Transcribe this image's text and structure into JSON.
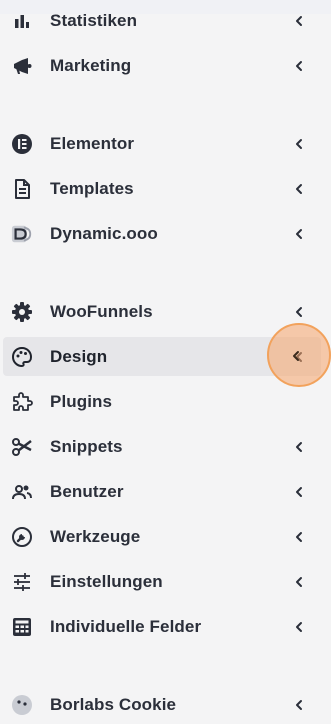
{
  "menu": {
    "items": [
      {
        "label": "Statistiken",
        "icon": "bar-chart-icon"
      },
      {
        "label": "Marketing",
        "icon": "megaphone-icon"
      },
      {
        "label": "Elementor",
        "icon": "elementor-icon"
      },
      {
        "label": "Templates",
        "icon": "document-icon"
      },
      {
        "label": "Dynamic.ooo",
        "icon": "dynamic-logo-icon"
      },
      {
        "label": "WooFunnels",
        "icon": "gear-icon"
      },
      {
        "label": "Design",
        "icon": "palette-icon",
        "active": true
      },
      {
        "label": "Plugins",
        "icon": "puzzle-icon"
      },
      {
        "label": "Snippets",
        "icon": "scissors-icon"
      },
      {
        "label": "Benutzer",
        "icon": "users-icon"
      },
      {
        "label": "Werkzeuge",
        "icon": "wrench-icon"
      },
      {
        "label": "Einstellungen",
        "icon": "sliders-icon"
      },
      {
        "label": "Individuelle Felder",
        "icon": "table-grid-icon"
      },
      {
        "label": "Borlabs Cookie",
        "icon": "cookie-icon"
      }
    ]
  },
  "colors": {
    "background": "#f4f4f5",
    "text": "#2b2f3a",
    "active_background": "#e6e6e9",
    "highlight": "#f2a25c"
  }
}
